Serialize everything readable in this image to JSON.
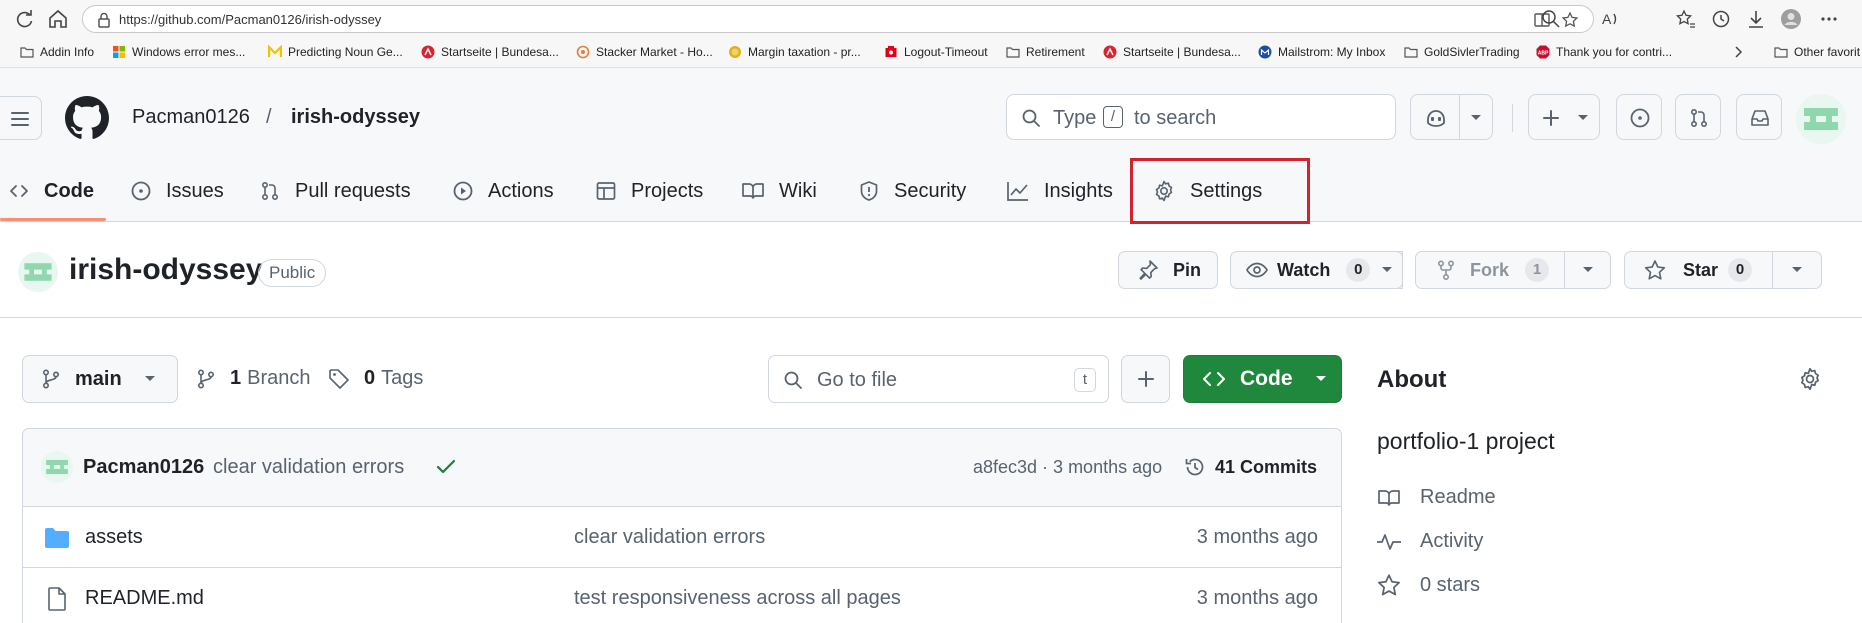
{
  "browser": {
    "url": "https://github.com/Pacman0126/irish-odyssey",
    "bookmarks": [
      {
        "label": "Addin Info",
        "icon": "folder-icon",
        "color": "#555555"
      },
      {
        "label": "Windows error mes...",
        "icon": "windows-logo-icon",
        "color": "#0078d4"
      },
      {
        "label": "Predicting Noun Ge...",
        "icon": "m-logo-icon",
        "color": "#f2c200"
      },
      {
        "label": "Startseite | Bundesa...",
        "icon": "agency-logo-icon",
        "color": "#d9232e"
      },
      {
        "label": "Stacker Market - Ho...",
        "icon": "stacker-icon",
        "color": "#e08040"
      },
      {
        "label": "Margin taxation - pr...",
        "icon": "coin-icon",
        "color": "#e0b020"
      },
      {
        "label": "Logout-Timeout",
        "icon": "bank-icon",
        "color": "#e3001b"
      },
      {
        "label": "Retirement",
        "icon": "folder-icon",
        "color": "#555555"
      },
      {
        "label": "Startseite | Bundesa...",
        "icon": "agency-logo-icon",
        "color": "#d9232e"
      },
      {
        "label": "Mailstrom: My Inbox",
        "icon": "mailstrom-icon",
        "color": "#1a4fa0"
      },
      {
        "label": "GoldSivlerTrading",
        "icon": "folder-icon",
        "color": "#555555"
      },
      {
        "label": "Thank you for contri...",
        "icon": "abp-icon",
        "color": "#c8102e"
      }
    ],
    "other_favorites": "Other favorit"
  },
  "header": {
    "owner": "Pacman0126",
    "separator": "/",
    "repo": "irish-odyssey",
    "search_placeholder_pre": "Type",
    "search_key": "/",
    "search_placeholder_post": "to search"
  },
  "tabs": [
    {
      "label": "Code",
      "icon": "code-icon",
      "active": true
    },
    {
      "label": "Issues",
      "icon": "issue-opened-icon"
    },
    {
      "label": "Pull requests",
      "icon": "git-pull-request-icon"
    },
    {
      "label": "Actions",
      "icon": "play-icon"
    },
    {
      "label": "Projects",
      "icon": "table-icon"
    },
    {
      "label": "Wiki",
      "icon": "book-icon"
    },
    {
      "label": "Security",
      "icon": "shield-icon"
    },
    {
      "label": "Insights",
      "icon": "graph-icon"
    },
    {
      "label": "Settings",
      "icon": "gear-icon",
      "highlighted": true
    }
  ],
  "highlight_color": "#d1242f",
  "repo": {
    "name": "irish-odyssey",
    "visibility": "Public",
    "pin_label": "Pin",
    "watch_label": "Watch",
    "watch_count": "0",
    "fork_label": "Fork",
    "fork_count": "1",
    "star_label": "Star",
    "star_count": "0"
  },
  "file_nav": {
    "branch": "main",
    "branches_count": "1",
    "branches_label": "Branch",
    "tags_count": "0",
    "tags_label": "Tags",
    "go_to_file": "Go to file",
    "go_to_file_key": "t",
    "code_button": "Code"
  },
  "latest_commit": {
    "author": "Pacman0126",
    "message": "clear validation errors",
    "hash_and_time": "a8fec3d · 3 months ago",
    "commits_count": "41 Commits"
  },
  "files": [
    {
      "name": "assets",
      "type": "folder",
      "message": "clear validation errors",
      "date": "3 months ago"
    },
    {
      "name": "README.md",
      "type": "file",
      "message": "test responsiveness across all pages",
      "date": "3 months ago"
    }
  ],
  "about": {
    "title": "About",
    "description": "portfolio-1 project",
    "items": [
      {
        "label": "Readme",
        "icon": "book-icon"
      },
      {
        "label": "Activity",
        "icon": "pulse-icon"
      },
      {
        "label": "0 stars",
        "icon": "star-icon"
      }
    ]
  },
  "colors": {
    "primary_green": "#1f883d",
    "folder_blue": "#54aeff",
    "active_tab_underline": "#fd8c73"
  }
}
